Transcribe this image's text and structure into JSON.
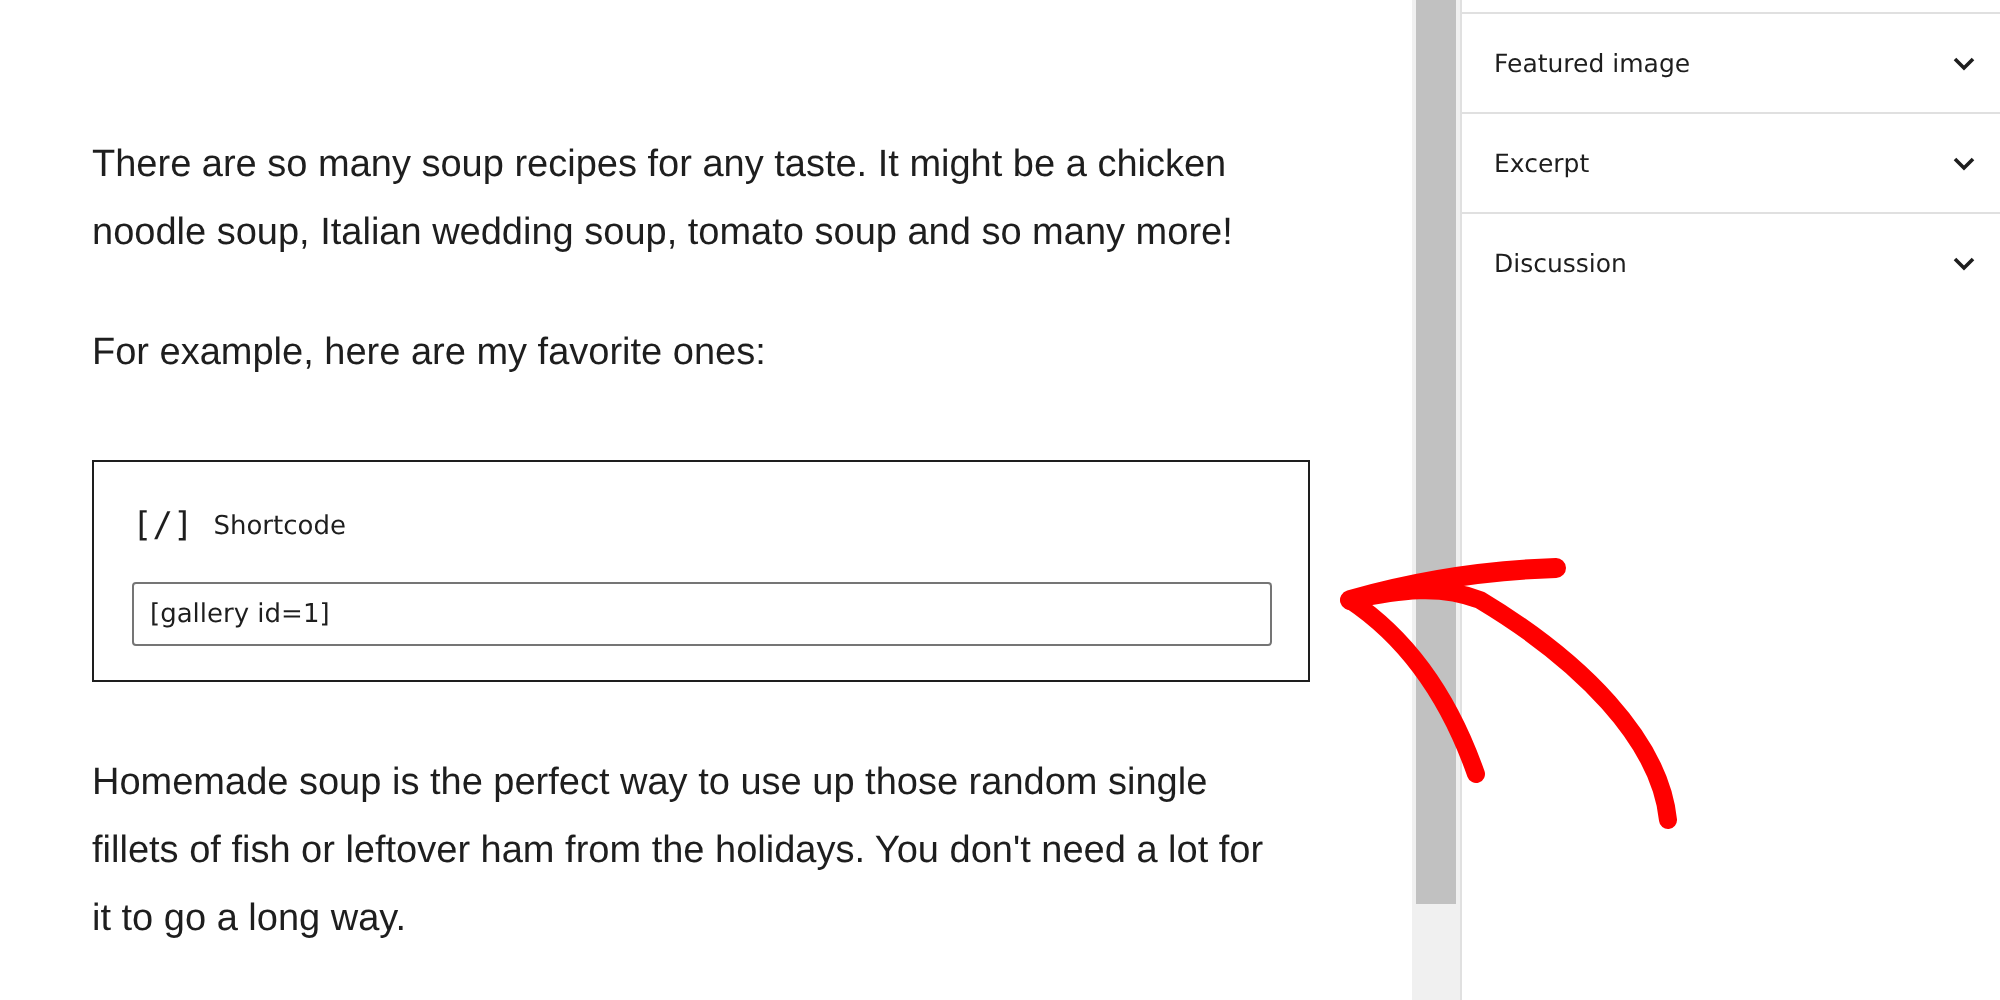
{
  "editor": {
    "blocks": [
      {
        "kind": "paragraph",
        "text": "There are so many soup recipes for any taste. It might be a chicken noodle soup, Italian wedding soup, tomato soup and so many more!"
      },
      {
        "kind": "paragraph",
        "text": "For example, here are my favorite ones:"
      },
      {
        "kind": "shortcode",
        "icon": "[/]",
        "label": "Shortcode",
        "value": "[gallery id=1]"
      },
      {
        "kind": "paragraph",
        "text": "Homemade soup is the perfect way to use up those random single fillets of fish or leftover ham from the holidays. You don't need a lot for it to go a long way."
      }
    ]
  },
  "sidebar": {
    "panels": [
      {
        "title": "Featured image",
        "expanded": false
      },
      {
        "title": "Excerpt",
        "expanded": false
      },
      {
        "title": "Discussion",
        "expanded": false
      }
    ]
  }
}
